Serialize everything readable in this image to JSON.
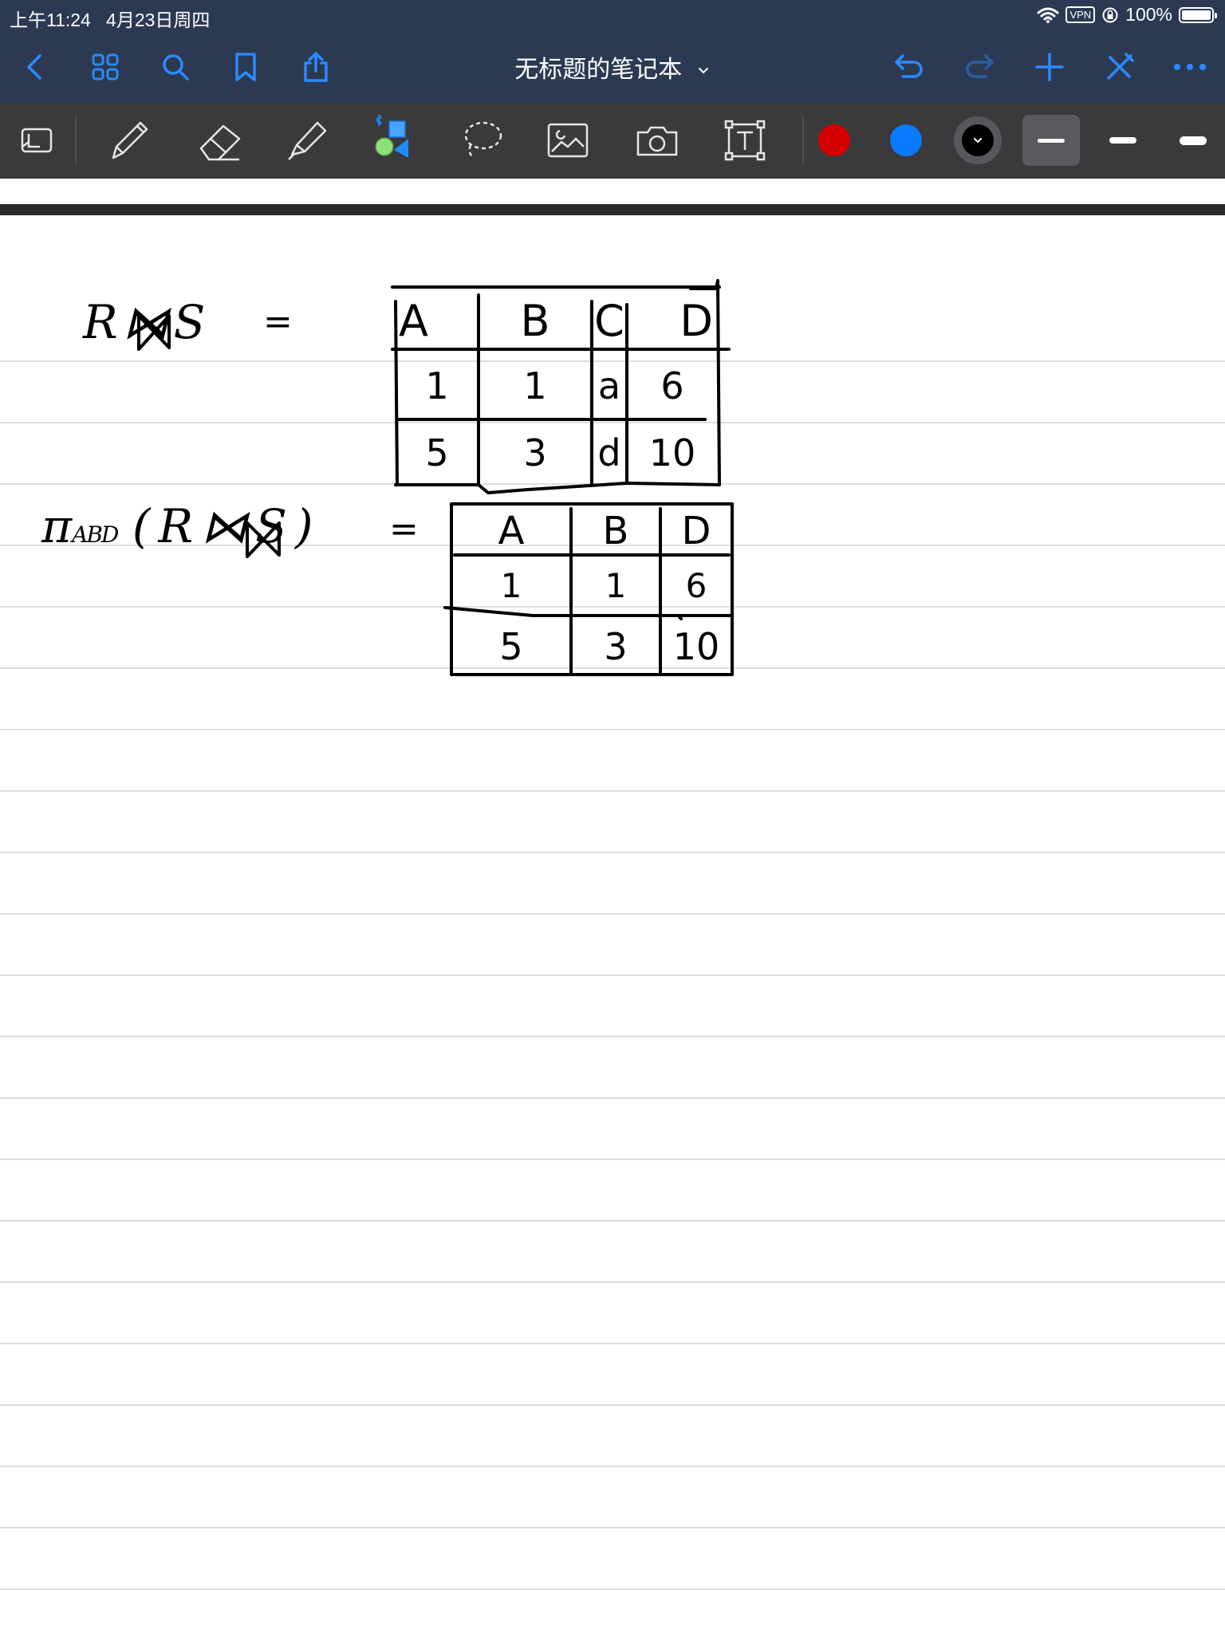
{
  "status_bar": {
    "time": "上午11:24",
    "date": "4月23日周四",
    "vpn_label": "VPN",
    "battery_text": "100%",
    "battery_level": 1.0
  },
  "nav": {
    "title": "无标题的笔记本",
    "title_dropdown_icon": "chevron-down-icon",
    "left_icons": [
      "back-chevron-icon",
      "grid-icon",
      "search-icon",
      "bookmark-icon",
      "share-icon"
    ],
    "right_icons": [
      "undo-icon",
      "redo-icon",
      "add-icon",
      "close-stylus-icon",
      "more-icon"
    ]
  },
  "toolbar": {
    "tools": [
      "zoom-window-icon",
      "pen-icon",
      "eraser-icon",
      "highlighter-icon",
      "shapes-icon",
      "lasso-icon",
      "image-icon",
      "camera-icon",
      "text-box-icon"
    ],
    "colors": [
      "#d40000",
      "#0a7aff",
      "#000000"
    ],
    "selected_color": "#000000",
    "stroke_weights": [
      "thin",
      "medium",
      "thick"
    ],
    "selected_weight": "thin"
  },
  "theme": {
    "bar_bg": "#2b3a52",
    "toolbar_bg": "#3a3a3c",
    "accent": "#2b8aff",
    "rule_line": "#d3d3d3"
  },
  "notes": {
    "expr1": {
      "left": "R⋈S",
      "eq": "="
    },
    "table1": {
      "headers": [
        "A",
        "B",
        "C",
        "D"
      ],
      "rows": [
        [
          "1",
          "1",
          "a",
          "6"
        ],
        [
          "5",
          "3",
          "d",
          "10"
        ]
      ]
    },
    "expr2": {
      "pi": "π",
      "subscript": "ABD",
      "args": "(R⋈S)",
      "eq": "="
    },
    "table2": {
      "headers": [
        "A",
        "B",
        "D"
      ],
      "rows": [
        [
          "1",
          "1",
          "6"
        ],
        [
          "5",
          "3",
          "10"
        ]
      ]
    }
  }
}
